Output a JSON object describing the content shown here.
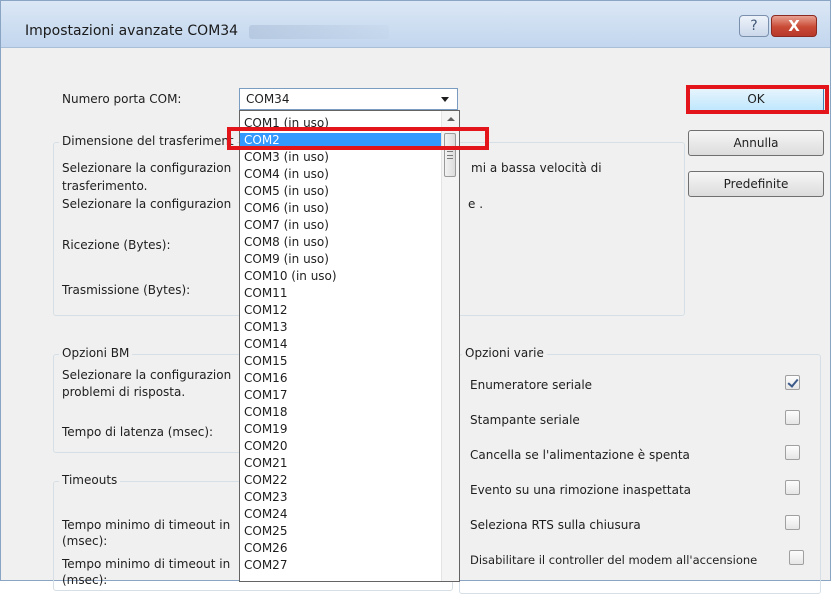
{
  "window": {
    "title": "Impostazioni avanzate COM34",
    "help_symbol": "?",
    "close_symbol": "X",
    "help_icon": "question-mark-icon",
    "close_icon": "close-x-icon"
  },
  "com_port": {
    "label": "Numero porta COM:",
    "selected": "COM34",
    "dropdown": {
      "highlighted": "COM2",
      "items": [
        "COM1 (in uso)",
        "COM2",
        "COM3 (in uso)",
        "COM4 (in uso)",
        "COM5 (in uso)",
        "COM6 (in uso)",
        "COM7 (in uso)",
        "COM8 (in uso)",
        "COM9 (in uso)",
        "COM10 (in uso)",
        "COM11",
        "COM12",
        "COM13",
        "COM14",
        "COM15",
        "COM16",
        "COM17",
        "COM18",
        "COM19",
        "COM20",
        "COM21",
        "COM22",
        "COM23",
        "COM24",
        "COM25",
        "COM26",
        "COM27"
      ]
    }
  },
  "transfer": {
    "title": "Dimensione del trasferiment",
    "line1a": "Selezionare la configurazion",
    "line1b": "mi a bassa velocità di",
    "line2": "trasferimento.",
    "line3a": "Selezionare la configurazion",
    "line3b": "e .",
    "rx_label": "Ricezione (Bytes):",
    "tx_label": "Trasmissione (Bytes):"
  },
  "bm": {
    "title": "Opzioni BM",
    "line1": "Selezionare la configurazion",
    "line2": "problemi di risposta.",
    "latency_label": "Tempo di latenza (msec):"
  },
  "timeouts": {
    "title": "Timeouts",
    "read_label_a": "Tempo minimo di timeout in",
    "read_label_b": "(msec):",
    "write_label_a": "Tempo minimo di timeout in",
    "write_label_b": "(msec):"
  },
  "misc": {
    "title": "Opzioni varie",
    "options": [
      {
        "label": "Enumeratore seriale",
        "checked": true
      },
      {
        "label": "Stampante seriale",
        "checked": false
      },
      {
        "label": "Cancella se l'alimentazione è spenta",
        "checked": false
      },
      {
        "label": "Evento su una rimozione inaspettata",
        "checked": false
      },
      {
        "label": "Seleziona RTS sulla chiusura",
        "checked": false
      },
      {
        "label": "Disabilitare il controller del modem all'accensione",
        "checked": false
      }
    ]
  },
  "buttons": {
    "ok": "OK",
    "cancel": "Annulla",
    "defaults": "Predefinite"
  },
  "colors": {
    "highlight_box": "#e3151b",
    "selection": "#3399ff"
  }
}
